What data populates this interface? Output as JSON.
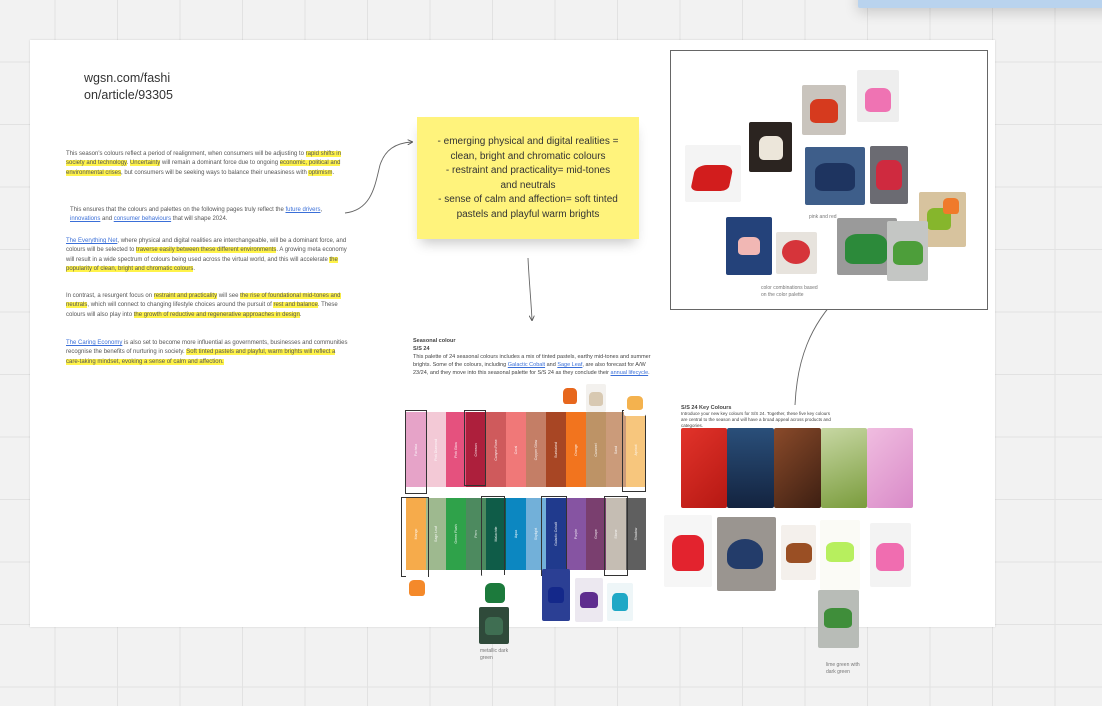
{
  "url_lines": [
    "wgsn.com/fashi",
    "on/article/93305"
  ],
  "paragraphs": {
    "p1": {
      "s1": "This season's colours reflect a period of realignment, when consumers will be adjusting to ",
      "h1": "rapid shifts in society and technology",
      "s2": ". ",
      "h2": "Uncertainty",
      "s3": " will remain a dominant force due to ongoing ",
      "h3": "economic, political and environmental crises",
      "s4": ", but consumers will be seeking ways to balance their uneasiness with ",
      "h4": "optimism",
      "s5": "."
    },
    "p2": {
      "s1": "This ensures that the colours and palettes on the following pages truly reflect the ",
      "l1": "future drivers",
      "s2": ", ",
      "l2": "innovations",
      "s3": " and ",
      "l3": "consumer behaviours",
      "s4": " that will shape 2024."
    },
    "p3": {
      "l1": "The Everything Net",
      "s1": ", where physical and digital realities are interchangeable, will be a dominant force, and colours will be selected to ",
      "h1": "traverse easily between these different environments",
      "s2": ". A growing meta economy will result in a wide spectrum of colours being used across the virtual world, and this will accelerate ",
      "h2": "the popularity of clean, bright and chromatic colours",
      "s3": "."
    },
    "p4": {
      "s1": "In contrast, a resurgent focus on ",
      "h1": "restraint and practicality",
      "s2": " will see ",
      "h2": "the rise of foundational mid-tones and neutrals",
      "s3": ", which will connect to changing lifestyle choices around the pursuit of ",
      "h3": "rest and balance",
      "s4": ". These colours will also play into ",
      "h4": "the growth of reductive and regenerative approaches in design",
      "s5": "."
    },
    "p5": {
      "l1": "The Caring Economy",
      "s1": " is also set to become more influential as governments, businesses and communities recognise the benefits of nurturing in society. ",
      "h1": "Soft tinted pastels and playful, warm brights will reflect a care-taking mindset, evoking a sense of calm and affection."
    }
  },
  "sticky_lines": [
    "- emerging physical and digital realities =",
    "clean, bright and chromatic colours",
    "- restraint and practicality= mid-tones",
    "and neutrals",
    "- sense of calm and affection= soft tinted",
    "pastels and playful warm brights"
  ],
  "seasonal": {
    "title": "Seasonal colour",
    "subtitle": "S/S 24",
    "body_1": "This palette of 24 seasonal colours includes a mix of tinted pastels, earthy mid-tones and summer brights. Some of the colours, including ",
    "link_1": "Galactic Cobalt",
    "body_2": " and ",
    "link_2": "Sage Leaf",
    "body_3": ", are also forecast for A/W 23/24, and they move into this seasonal palette for S/S 24 as they conclude their ",
    "link_3": "annual lifecycle",
    "body_4": "."
  },
  "palette_row1": [
    {
      "color": "#e6a3c8",
      "name": "Fuchsia"
    },
    {
      "color": "#f3c9d6",
      "name": "Pink Diamond"
    },
    {
      "color": "#e5517e",
      "name": "Pink Glow"
    },
    {
      "color": "#ad1f3c",
      "name": "Crimson"
    },
    {
      "color": "#cf5a5c",
      "name": "Canyon Rose"
    },
    {
      "color": "#f07878",
      "name": "Coral"
    },
    {
      "color": "#c47e66",
      "name": "Copper Glow"
    },
    {
      "color": "#a84624",
      "name": "Sunbaked"
    },
    {
      "color": "#f2741e",
      "name": "Orange"
    },
    {
      "color": "#bd9366",
      "name": "Caramel"
    },
    {
      "color": "#cb9b7a",
      "name": "Sand"
    },
    {
      "color": "#f7c67d",
      "name": "Apricot"
    }
  ],
  "palette_row2": [
    {
      "color": "#f6ab4b",
      "name": "Mango"
    },
    {
      "color": "#9eb98f",
      "name": "Sage Leaf"
    },
    {
      "color": "#2fa24a",
      "name": "Green Flash"
    },
    {
      "color": "#4d8a5f",
      "name": "Fern"
    },
    {
      "color": "#0f5c48",
      "name": "Malachite"
    },
    {
      "color": "#0c87c1",
      "name": "Aqua"
    },
    {
      "color": "#72b0d9",
      "name": "Skylight"
    },
    {
      "color": "#203a8d",
      "name": "Galactic Cobalt"
    },
    {
      "color": "#8654a2",
      "name": "Purple"
    },
    {
      "color": "#7a3f6f",
      "name": "Grape"
    },
    {
      "color": "#c5bdb3",
      "name": "Stone"
    },
    {
      "color": "#5f5f5f",
      "name": "Shadow"
    }
  ],
  "captions": {
    "pink_red": "pink and red",
    "combinations": [
      "color combinations based",
      "on the color palette"
    ],
    "metallic": [
      "metallic dark",
      "green"
    ],
    "lime": [
      "lime green with",
      "dark green"
    ]
  },
  "key_colours": {
    "title": "S/S 24 Key Colours",
    "body": "Introduce your new key colours for S/S 24. Together, these five key colours are central to the season and will have a broad appeal across products and categories."
  }
}
